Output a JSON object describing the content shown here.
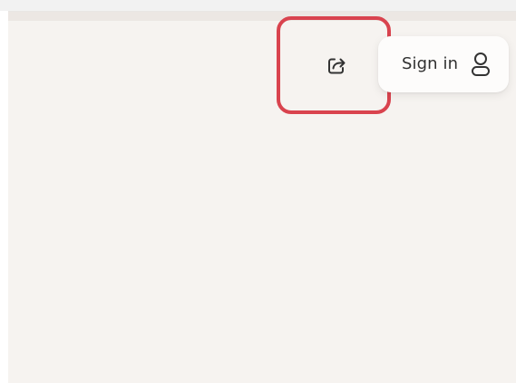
{
  "header": {
    "share_icon": "share-icon",
    "signin_label": "Sign in",
    "user_icon": "user-icon"
  },
  "colors": {
    "background": "#f6f3f0",
    "highlight": "#d9434e",
    "text": "#303030"
  }
}
